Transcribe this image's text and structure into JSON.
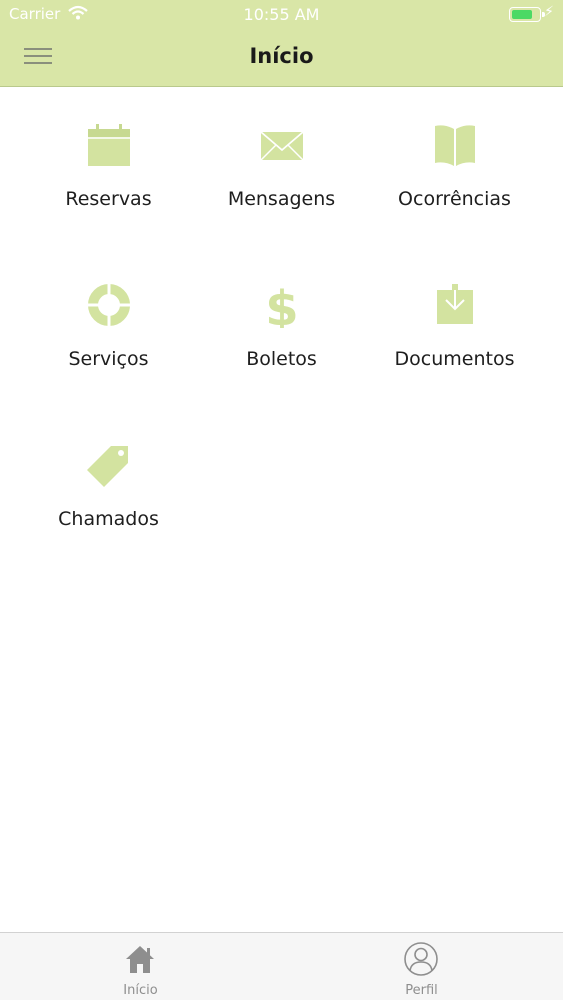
{
  "status_bar": {
    "carrier": "Carrier",
    "time": "10:55 AM",
    "battery_level": 0.8
  },
  "header": {
    "title": "Início",
    "menu_icon": "hamburger-menu-icon"
  },
  "grid": [
    {
      "label": "Reservas",
      "icon": "calendar-icon"
    },
    {
      "label": "Mensagens",
      "icon": "envelope-icon"
    },
    {
      "label": "Ocorrências",
      "icon": "book-icon"
    },
    {
      "label": "Serviços",
      "icon": "lifebuoy-icon"
    },
    {
      "label": "Boletos",
      "icon": "dollar-icon"
    },
    {
      "label": "Documentos",
      "icon": "download-box-icon"
    },
    {
      "label": "Chamados",
      "icon": "tag-icon"
    }
  ],
  "tabbar": [
    {
      "label": "Início",
      "icon": "home-icon"
    },
    {
      "label": "Perfil",
      "icon": "user-circle-icon"
    }
  ],
  "colors": {
    "header_bg": "#d9e6a7",
    "icon_green": "#d3e3a0",
    "tab_icon": "#8e8e8e",
    "battery_fill": "#4cd964"
  }
}
